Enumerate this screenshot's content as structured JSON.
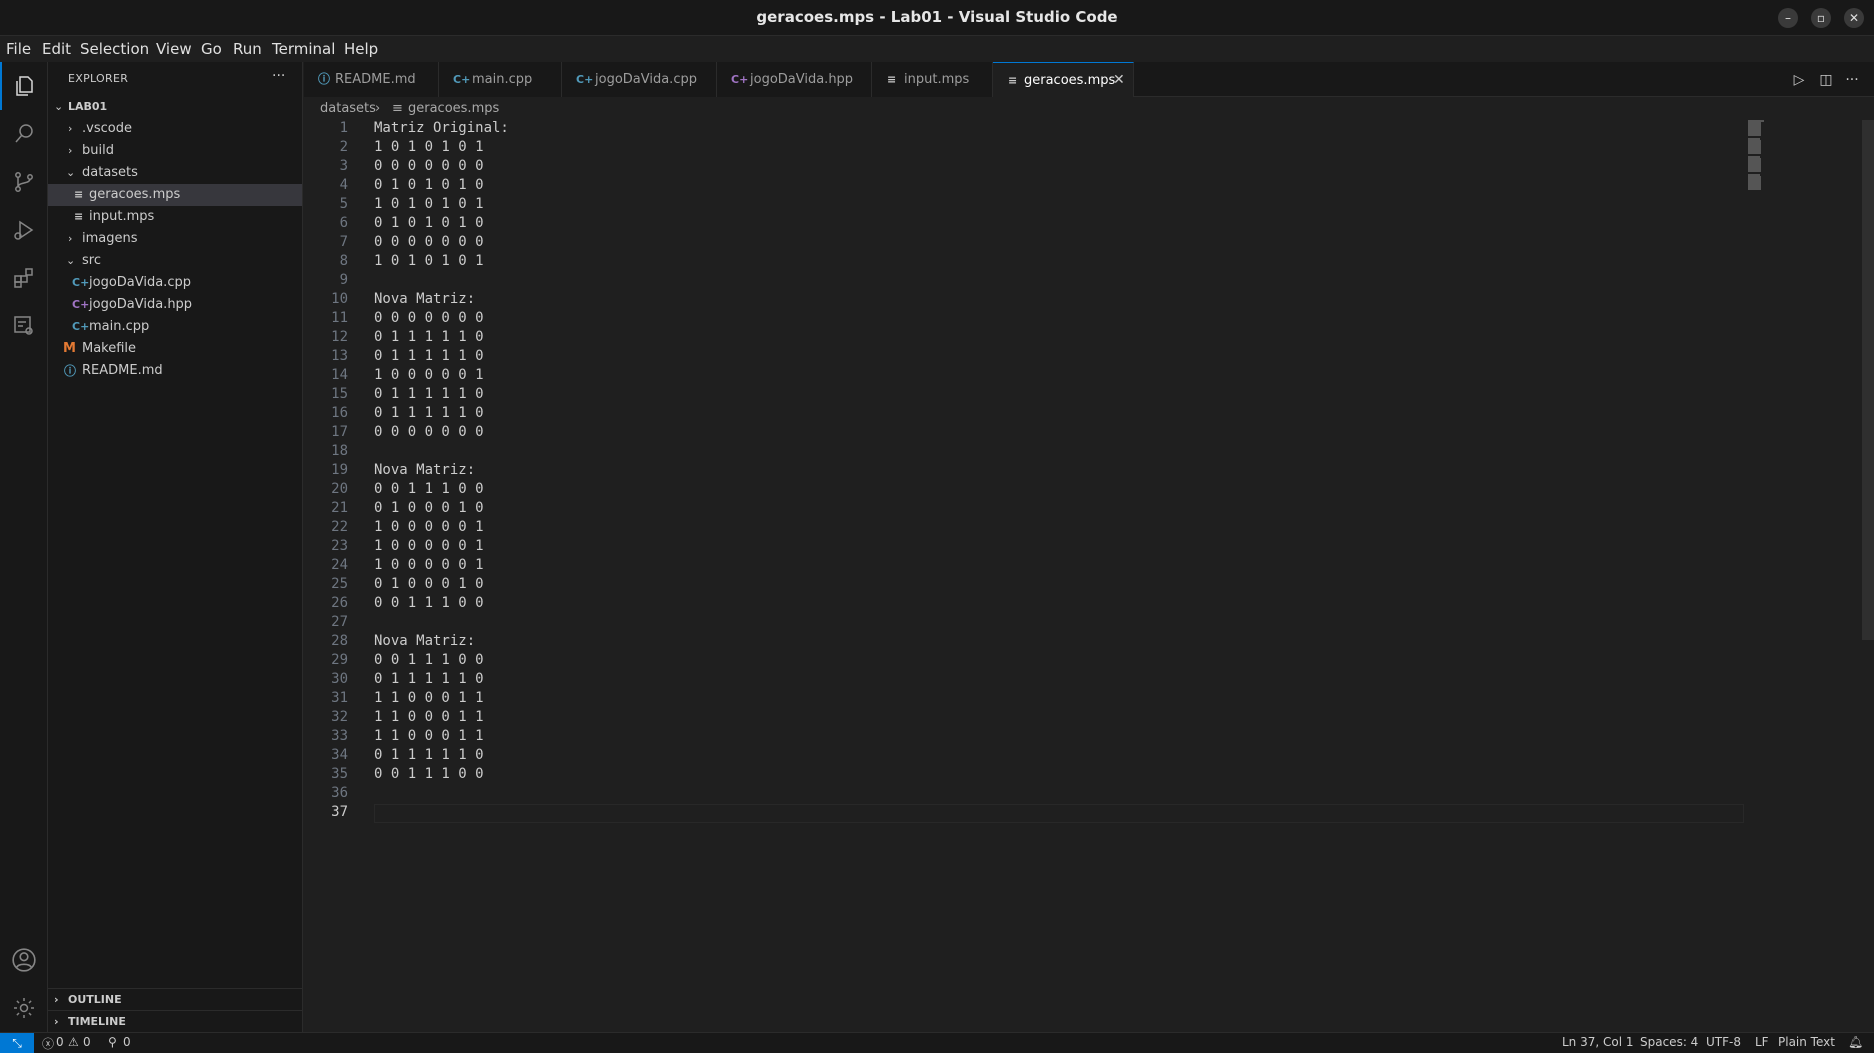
{
  "window": {
    "title": "geracoes.mps - Lab01 - Visual Studio Code"
  },
  "menu": [
    "File",
    "Edit",
    "Selection",
    "View",
    "Go",
    "Run",
    "Terminal",
    "Help"
  ],
  "explorer": {
    "header": "EXPLORER",
    "more": "···",
    "root": "LAB01",
    "items": [
      {
        "label": ".vscode"
      },
      {
        "label": "build"
      },
      {
        "label": "datasets"
      },
      {
        "label": "geracoes.mps"
      },
      {
        "label": "input.mps"
      },
      {
        "label": "imagens"
      },
      {
        "label": "src"
      },
      {
        "label": "jogoDaVida.cpp"
      },
      {
        "label": "jogoDaVida.hpp"
      },
      {
        "label": "main.cpp"
      },
      {
        "label": "Makefile"
      },
      {
        "label": "README.md"
      }
    ],
    "outline": "OUTLINE",
    "timeline": "TIMELINE"
  },
  "tabs": [
    {
      "label": "README.md"
    },
    {
      "label": "main.cpp"
    },
    {
      "label": "jogoDaVida.cpp"
    },
    {
      "label": "jogoDaVida.hpp"
    },
    {
      "label": "input.mps"
    },
    {
      "label": "geracoes.mps"
    }
  ],
  "breadcrumb": {
    "folder": "datasets",
    "file": "geracoes.mps"
  },
  "editor": {
    "lines": [
      "Matriz Original:",
      "1 0 1 0 1 0 1",
      "0 0 0 0 0 0 0",
      "0 1 0 1 0 1 0",
      "1 0 1 0 1 0 1",
      "0 1 0 1 0 1 0",
      "0 0 0 0 0 0 0",
      "1 0 1 0 1 0 1",
      "",
      "Nova Matriz:",
      "0 0 0 0 0 0 0",
      "0 1 1 1 1 1 0",
      "0 1 1 1 1 1 0",
      "1 0 0 0 0 0 1",
      "0 1 1 1 1 1 0",
      "0 1 1 1 1 1 0",
      "0 0 0 0 0 0 0",
      "",
      "Nova Matriz:",
      "0 0 1 1 1 0 0",
      "0 1 0 0 0 1 0",
      "1 0 0 0 0 0 1",
      "1 0 0 0 0 0 1",
      "1 0 0 0 0 0 1",
      "0 1 0 0 0 1 0",
      "0 0 1 1 1 0 0",
      "",
      "Nova Matriz:",
      "0 0 1 1 1 0 0",
      "0 1 1 1 1 1 0",
      "1 1 0 0 0 1 1",
      "1 1 0 0 0 1 1",
      "1 1 0 0 0 1 1",
      "0 1 1 1 1 1 0",
      "0 0 1 1 1 0 0",
      "",
      ""
    ]
  },
  "status": {
    "errors": "0",
    "warnings": "0",
    "ports": "0",
    "position": "Ln 37, Col 1",
    "spaces": "Spaces: 4",
    "encoding": "UTF-8",
    "eol": "LF",
    "language": "Plain Text"
  },
  "colors": {
    "accent": "#0078d4",
    "cpp_icon": "#519aba",
    "hpp_icon": "#a074c4",
    "makefile_icon": "#e37933"
  }
}
